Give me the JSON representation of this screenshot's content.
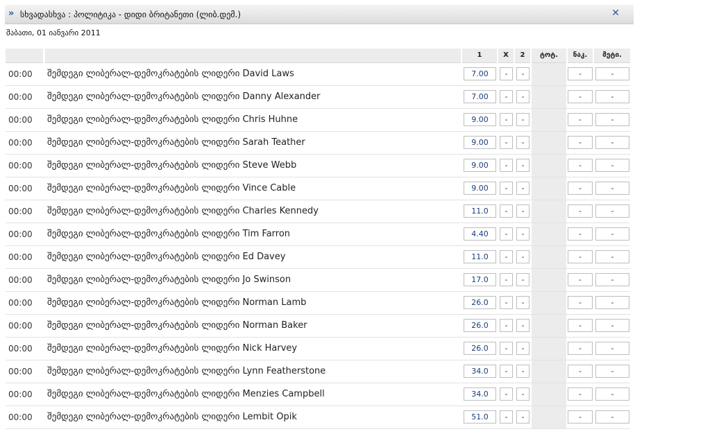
{
  "header": {
    "title": "სხვადასხვა : პოლიტიკა - დიდი ბრიტანეთი (ლიბ.დემ.)",
    "arrow_icon": "double-chevron-right-icon",
    "close_icon": "close-icon"
  },
  "date": "შაბათი, 01 იანვარი 2011",
  "columns": {
    "c1": "1",
    "cx": "X",
    "c2": "2",
    "tot": "ტოტ.",
    "nak": "ნაკ.",
    "met": "მეტი."
  },
  "event_prefix": "შემდეგი ლიბერალ-დემოკრატების ლიდერი",
  "rows": [
    {
      "time": "00:00",
      "name": "შემდეგი ლიბერალ-დემოკრატების ლიდერი David Laws",
      "odd1": "7.00",
      "oddx": "-",
      "odd2": "-",
      "nak": "-",
      "met": "-"
    },
    {
      "time": "00:00",
      "name": "შემდეგი ლიბერალ-დემოკრატების ლიდერი Danny Alexander",
      "odd1": "7.00",
      "oddx": "-",
      "odd2": "-",
      "nak": "-",
      "met": "-"
    },
    {
      "time": "00:00",
      "name": "შემდეგი ლიბერალ-დემოკრატების ლიდერი Chris Huhne",
      "odd1": "9.00",
      "oddx": "-",
      "odd2": "-",
      "nak": "-",
      "met": "-"
    },
    {
      "time": "00:00",
      "name": "შემდეგი ლიბერალ-დემოკრატების ლიდერი Sarah Teather",
      "odd1": "9.00",
      "oddx": "-",
      "odd2": "-",
      "nak": "-",
      "met": "-"
    },
    {
      "time": "00:00",
      "name": "შემდეგი ლიბერალ-დემოკრატების ლიდერი Steve Webb",
      "odd1": "9.00",
      "oddx": "-",
      "odd2": "-",
      "nak": "-",
      "met": "-"
    },
    {
      "time": "00:00",
      "name": "შემდეგი ლიბერალ-დემოკრატების ლიდერი Vince Cable",
      "odd1": "9.00",
      "oddx": "-",
      "odd2": "-",
      "nak": "-",
      "met": "-"
    },
    {
      "time": "00:00",
      "name": "შემდეგი ლიბერალ-დემოკრატების ლიდერი Charles Kennedy",
      "odd1": "11.0",
      "oddx": "-",
      "odd2": "-",
      "nak": "-",
      "met": "-"
    },
    {
      "time": "00:00",
      "name": "შემდეგი ლიბერალ-დემოკრატების ლიდერი Tim Farron",
      "odd1": "4.40",
      "oddx": "-",
      "odd2": "-",
      "nak": "-",
      "met": "-"
    },
    {
      "time": "00:00",
      "name": "შემდეგი ლიბერალ-დემოკრატების ლიდერი Ed Davey",
      "odd1": "11.0",
      "oddx": "-",
      "odd2": "-",
      "nak": "-",
      "met": "-"
    },
    {
      "time": "00:00",
      "name": "შემდეგი ლიბერალ-დემოკრატების ლიდერი Jo Swinson",
      "odd1": "17.0",
      "oddx": "-",
      "odd2": "-",
      "nak": "-",
      "met": "-"
    },
    {
      "time": "00:00",
      "name": "შემდეგი ლიბერალ-დემოკრატების ლიდერი Norman Lamb",
      "odd1": "26.0",
      "oddx": "-",
      "odd2": "-",
      "nak": "-",
      "met": "-"
    },
    {
      "time": "00:00",
      "name": "შემდეგი ლიბერალ-დემოკრატების ლიდერი Norman Baker",
      "odd1": "26.0",
      "oddx": "-",
      "odd2": "-",
      "nak": "-",
      "met": "-"
    },
    {
      "time": "00:00",
      "name": "შემდეგი ლიბერალ-დემოკრატების ლიდერი Nick Harvey",
      "odd1": "26.0",
      "oddx": "-",
      "odd2": "-",
      "nak": "-",
      "met": "-"
    },
    {
      "time": "00:00",
      "name": "შემდეგი ლიბერალ-დემოკრატების ლიდერი Lynn Featherstone",
      "odd1": "34.0",
      "oddx": "-",
      "odd2": "-",
      "nak": "-",
      "met": "-"
    },
    {
      "time": "00:00",
      "name": "შემდეგი ლიბერალ-დემოკრატების ლიდერი Menzies Campbell",
      "odd1": "34.0",
      "oddx": "-",
      "odd2": "-",
      "nak": "-",
      "met": "-"
    },
    {
      "time": "00:00",
      "name": "შემდეგი ლიბერალ-დემოკრატების ლიდერი Lembit Opik",
      "odd1": "51.0",
      "oddx": "-",
      "odd2": "-",
      "nak": "-",
      "met": "-"
    }
  ]
}
